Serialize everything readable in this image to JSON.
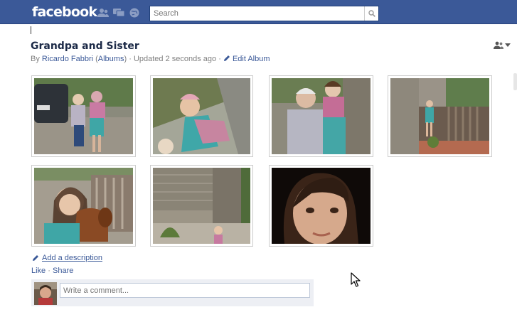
{
  "topbar": {
    "logo": "facebook",
    "icons": [
      "friend-requests-icon",
      "messages-icon",
      "notifications-icon"
    ],
    "search": {
      "placeholder": "Search",
      "value": ""
    }
  },
  "album": {
    "title": "Grandpa and Sister",
    "by_label": "By",
    "author": "Ricardo Fabbri",
    "albums_link": "Albums",
    "updated": "Updated 2 seconds ago",
    "edit_label": "Edit Album",
    "privacy_icon": "friends-privacy-icon"
  },
  "photos": [
    {
      "name": "photo-grandpa-sister-car",
      "subject": "grandpa-and-sister-by-car"
    },
    {
      "name": "photo-sister-tilted",
      "subject": "sister-tilted"
    },
    {
      "name": "photo-grandpa-hug",
      "subject": "grandpa-hugging-sister"
    },
    {
      "name": "photo-sister-porch",
      "subject": "sister-on-porch"
    },
    {
      "name": "photo-sister-dog",
      "subject": "sister-with-dachshund"
    },
    {
      "name": "photo-sister-shed",
      "subject": "sister-by-wooden-shed"
    },
    {
      "name": "photo-sister-closeup",
      "subject": "sister-close-up"
    }
  ],
  "actions": {
    "add_description": "Add a description",
    "like": "Like",
    "share": "Share",
    "sep": "·"
  },
  "comment": {
    "placeholder": "Write a comment..."
  },
  "colors": {
    "brand": "#3b5998",
    "brand_dark": "#29447e",
    "link": "#3b5998",
    "comment_bg": "#edeff4"
  }
}
